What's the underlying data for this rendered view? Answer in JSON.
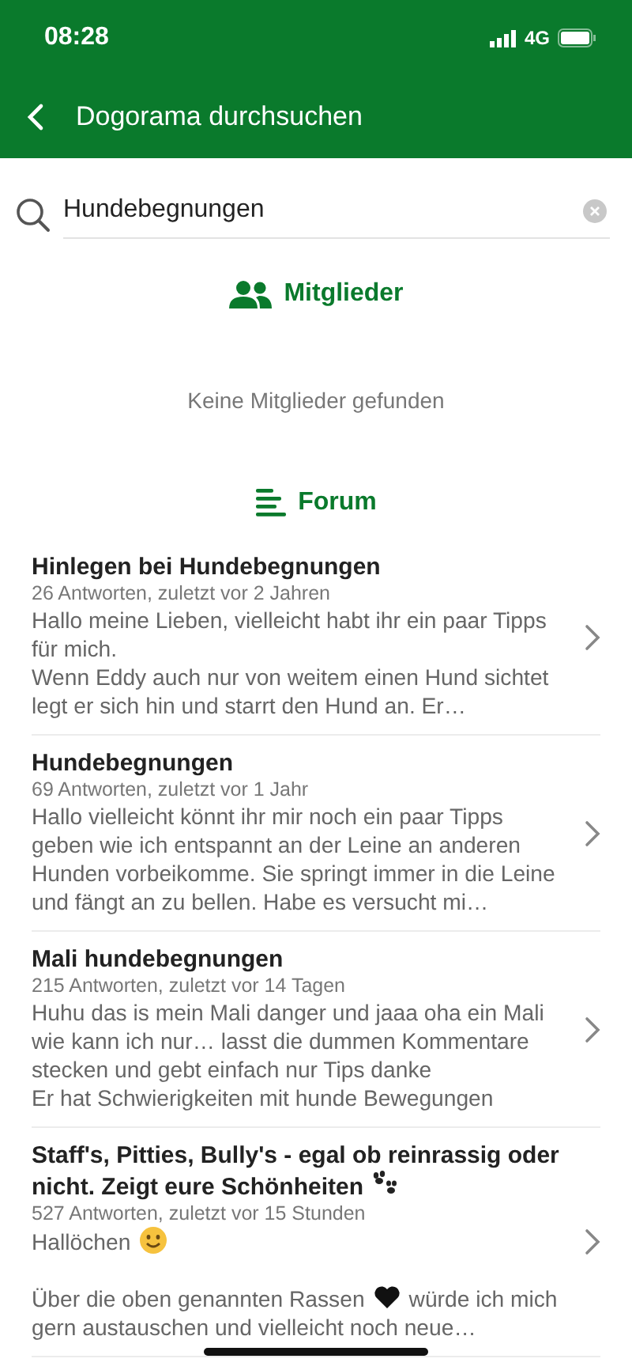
{
  "status_bar": {
    "time": "08:28",
    "network": "4G"
  },
  "header": {
    "title": "Dogorama durchsuchen"
  },
  "search": {
    "value": "Hundebegnungen"
  },
  "members": {
    "heading": "Mitglieder",
    "empty_message": "Keine Mitglieder gefunden"
  },
  "forum": {
    "heading": "Forum",
    "posts": [
      {
        "title": [
          {
            "kind": "text",
            "text": "Hinlegen bei Hundebegnungen"
          }
        ],
        "meta": "26 Antworten, zuletzt vor 2 Jahren",
        "excerpt": [
          [
            {
              "kind": "text",
              "text": "Hallo meine Lieben, vielleicht habt ihr ein paar Tipps für mich."
            }
          ],
          [
            {
              "kind": "text",
              "text": "Wenn Eddy auch nur von weitem einen Hund sichtet legt er sich hin und starrt den Hund an. Er…"
            }
          ]
        ]
      },
      {
        "title": [
          {
            "kind": "text",
            "text": "Hundebegnungen"
          }
        ],
        "meta": "69 Antworten, zuletzt vor 1 Jahr",
        "excerpt": [
          [
            {
              "kind": "text",
              "text": "Hallo vielleicht könnt ihr mir noch ein paar Tipps geben wie ich entspannt an der Leine an anderen Hunden vorbeikomme. Sie springt immer in die Leine und fängt an zu bellen. Habe es versucht mi…"
            }
          ]
        ]
      },
      {
        "title": [
          {
            "kind": "text",
            "text": "Mali hundebegnungen"
          }
        ],
        "meta": "215 Antworten, zuletzt vor 14 Tagen",
        "excerpt": [
          [
            {
              "kind": "text",
              "text": "Huhu das is mein Mali danger und jaaa oha ein Mali wie kann ich nur… lasst die dummen Kommentare stecken und gebt einfach nur Tips danke"
            }
          ],
          [
            {
              "kind": "text",
              "text": "Er hat Schwierigkeiten mit hunde Bewegungen"
            }
          ]
        ]
      },
      {
        "title": [
          {
            "kind": "text",
            "text": "Staff's, Pitties, Bully's - egal ob reinrassig oder nicht. Zeigt eure Schönheiten"
          },
          {
            "kind": "paw"
          }
        ],
        "meta": "527 Antworten, zuletzt vor 15 Stunden",
        "excerpt": [
          [
            {
              "kind": "text",
              "text": "Hallöchen"
            },
            {
              "kind": "smiley"
            }
          ],
          [
            {
              "kind": "blank"
            },
            {
              "kind": "text",
              "text": "Über die oben genannten Rassen"
            },
            {
              "kind": "heart"
            },
            {
              "kind": "text",
              "text": "würde ich mich gern austauschen und vielleicht noch neue…"
            }
          ]
        ]
      }
    ]
  }
}
